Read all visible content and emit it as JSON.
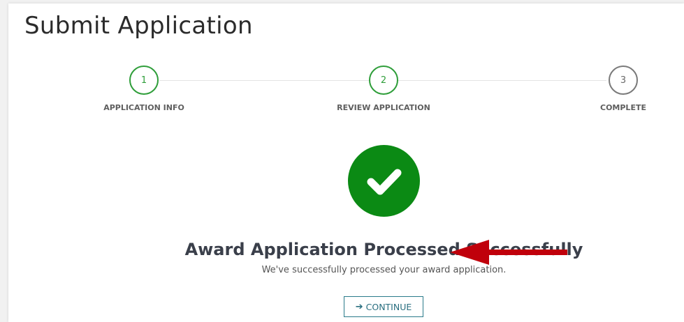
{
  "page": {
    "title": "Submit Application"
  },
  "stepper": {
    "steps": [
      {
        "number": "1",
        "label": "APPLICATION INFO",
        "state": "complete"
      },
      {
        "number": "2",
        "label": "REVIEW APPLICATION",
        "state": "complete"
      },
      {
        "number": "3",
        "label": "COMPLETE",
        "state": "pending"
      }
    ]
  },
  "result": {
    "icon": "check-circle-icon",
    "headline": "Award Application Processed Successfully",
    "message": "We've successfully processed your award application."
  },
  "actions": {
    "continue_label": "CONTINUE",
    "continue_icon": "arrow-right-icon"
  },
  "colors": {
    "success": "#0b8a14",
    "step_active": "#2f9e3a",
    "link": "#2a6f80",
    "annotation": "#c0000b"
  },
  "annotation": {
    "icon": "red-arrow-icon"
  }
}
